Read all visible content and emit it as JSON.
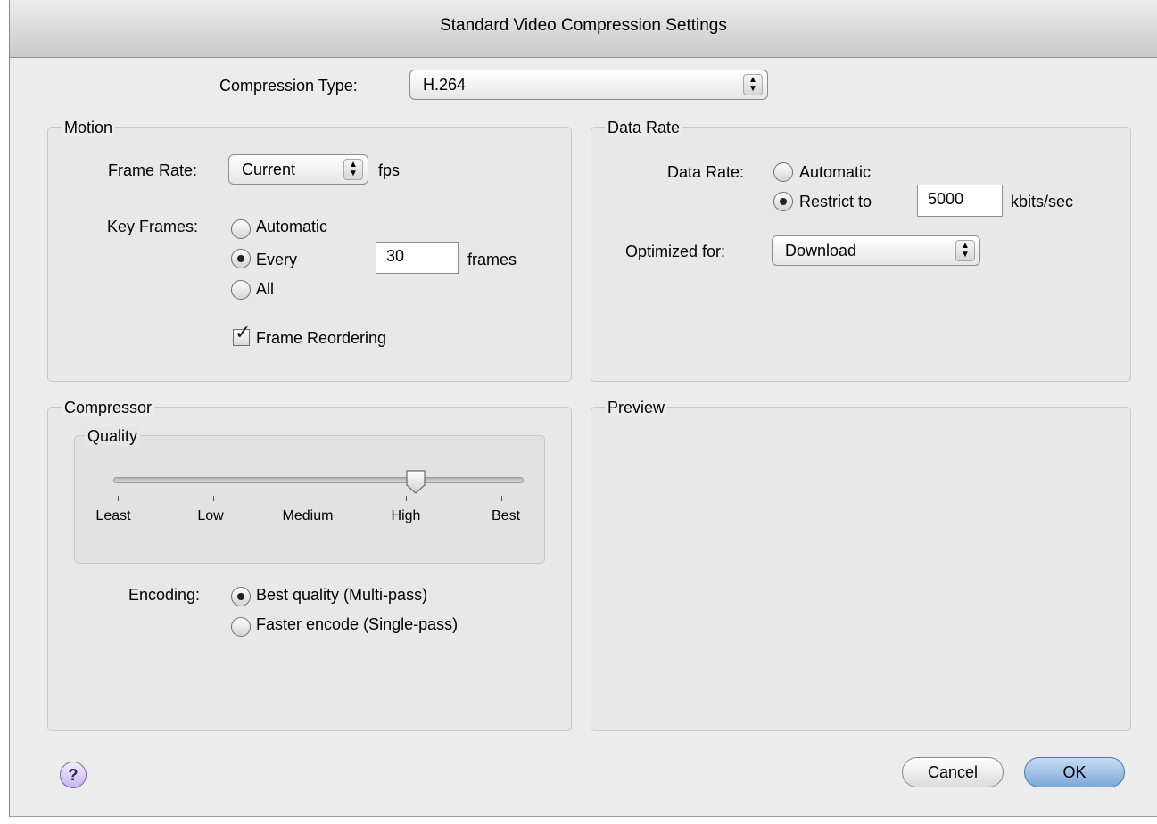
{
  "window": {
    "title": "Standard Video Compression Settings"
  },
  "compression": {
    "label": "Compression Type:",
    "value": "H.264"
  },
  "motion": {
    "title": "Motion",
    "frame_rate_label": "Frame Rate:",
    "frame_rate_value": "Current",
    "frame_rate_unit": "fps",
    "key_frames_label": "Key Frames:",
    "key_frames_options": [
      "Automatic",
      "Every",
      "All"
    ],
    "key_frames_selected": "Every",
    "key_frames_value": "30",
    "key_frames_unit": "frames",
    "frame_reordering_label": "Frame Reordering",
    "frame_reordering_checked": true
  },
  "data_rate": {
    "title": "Data Rate",
    "label": "Data Rate:",
    "options": [
      "Automatic",
      "Restrict to"
    ],
    "selected": "Restrict to",
    "value": "5000",
    "unit": "kbits/sec",
    "optimized_label": "Optimized for:",
    "optimized_value": "Download"
  },
  "compressor": {
    "title": "Compressor",
    "quality_title": "Quality",
    "quality_ticks": [
      "Least",
      "Low",
      "Medium",
      "High",
      "Best"
    ],
    "quality_selected": "High",
    "encoding_label": "Encoding:",
    "encoding_options": [
      "Best quality (Multi-pass)",
      "Faster encode (Single-pass)"
    ],
    "encoding_selected": "Best quality (Multi-pass)"
  },
  "preview": {
    "title": "Preview"
  },
  "buttons": {
    "help": "?",
    "cancel": "Cancel",
    "ok": "OK"
  },
  "icons": {
    "popup_arrows": "up-down-arrows-icon",
    "help": "help-icon",
    "check": "checkmark-icon"
  }
}
